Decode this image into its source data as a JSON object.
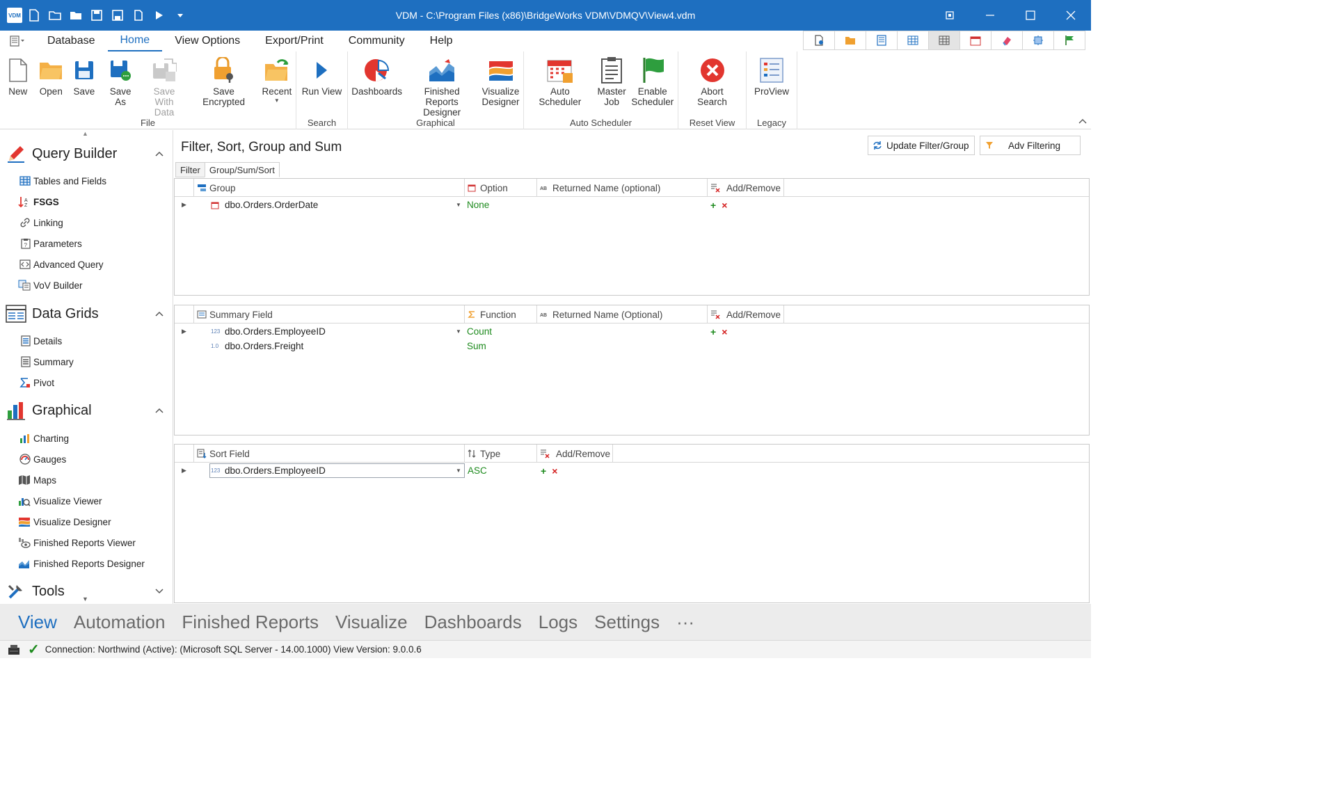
{
  "app": {
    "title": "VDM - C:\\Program Files (x86)\\BridgeWorks VDM\\VDMQV\\View4.vdm",
    "logo_text": "VDM"
  },
  "menu": {
    "tabs": [
      "Database",
      "Home",
      "View Options",
      "Export/Print",
      "Community",
      "Help"
    ],
    "active": "Home"
  },
  "ribbon": {
    "groups": {
      "file": "File",
      "search": "Search",
      "graphical": "Graphical",
      "auto_scheduler": "Auto Scheduler",
      "reset_view": "Reset View",
      "legacy": "Legacy"
    },
    "buttons": {
      "new": "New",
      "open": "Open",
      "save": "Save",
      "save_as": "Save As",
      "save_with_data": "Save With\nData",
      "save_encrypted": "Save Encrypted",
      "recent": "Recent",
      "run_view": "Run View",
      "dashboards": "Dashboards",
      "finished_reports_designer": "Finished Reports\nDesigner",
      "visualize_designer": "Visualize\nDesigner",
      "auto_scheduler": "Auto Scheduler",
      "master_job": "Master\nJob",
      "enable_scheduler": "Enable\nScheduler",
      "abort_search": "Abort\nSearch",
      "proview": "ProView"
    }
  },
  "leftnav": {
    "sections": {
      "query_builder": "Query Builder",
      "data_grids": "Data Grids",
      "graphical": "Graphical",
      "tools": "Tools"
    },
    "items": {
      "tables_fields": "Tables and Fields",
      "fsgs": "FSGS",
      "linking": "Linking",
      "parameters": "Parameters",
      "advanced_query": "Advanced Query",
      "vov_builder": "VoV Builder",
      "details": "Details",
      "summary": "Summary",
      "pivot": "Pivot",
      "charting": "Charting",
      "gauges": "Gauges",
      "maps": "Maps",
      "visualize_viewer": "Visualize Viewer",
      "visualize_designer": "Visualize Designer",
      "finished_reports_viewer": "Finished Reports Viewer",
      "finished_reports_designer": "Finished Reports Designer"
    }
  },
  "main": {
    "title": "Filter, Sort, Group and Sum",
    "update_btn": "Update Filter/Group",
    "adv_btn": "Adv Filtering",
    "subtabs": {
      "filter": "Filter",
      "group": "Group/Sum/Sort"
    },
    "group_grid": {
      "headers": {
        "field": "Group",
        "option": "Option",
        "returned": "Returned Name (optional)",
        "addremove": "Add/Remove"
      },
      "rows": [
        {
          "field": "dbo.Orders.OrderDate",
          "option": "None"
        }
      ]
    },
    "summary_grid": {
      "headers": {
        "field": "Summary Field",
        "function": "Function",
        "returned": "Returned Name (Optional)",
        "addremove": "Add/Remove"
      },
      "rows": [
        {
          "field": "dbo.Orders.EmployeeID",
          "function": "Count",
          "type_label": "123"
        },
        {
          "field": "dbo.Orders.Freight",
          "function": "Sum",
          "type_label": "1.0"
        }
      ]
    },
    "sort_grid": {
      "headers": {
        "field": "Sort Field",
        "type": "Type",
        "addremove": "Add/Remove"
      },
      "rows": [
        {
          "field": "dbo.Orders.EmployeeID",
          "type": "ASC",
          "type_label": "123"
        }
      ]
    }
  },
  "bottomnav": {
    "items": [
      "View",
      "Automation",
      "Finished Reports",
      "Visualize",
      "Dashboards",
      "Logs",
      "Settings",
      "···"
    ],
    "active": "View"
  },
  "status": {
    "text": "Connection: Northwind (Active): (Microsoft SQL Server - 14.00.1000) View Version: 9.0.0.6"
  },
  "colors": {
    "accent": "#1e6fc0",
    "green": "#1d8a1d",
    "red": "#d42020"
  }
}
